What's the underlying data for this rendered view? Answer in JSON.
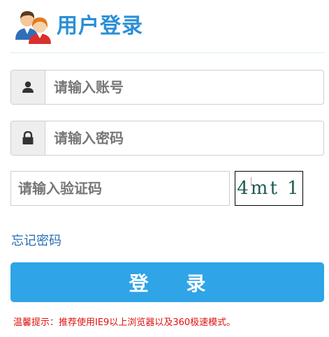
{
  "header": {
    "title": "用户登录",
    "icon": "users-icon"
  },
  "form": {
    "account": {
      "placeholder": "请输入账号",
      "value": "",
      "icon": "user-icon"
    },
    "password": {
      "placeholder": "请输入密码",
      "value": "",
      "icon": "lock-icon"
    },
    "captcha": {
      "placeholder": "请输入验证码",
      "value": "",
      "image_text": "4mt 1"
    },
    "forgot_link": "忘记密码",
    "login_button": "登 录"
  },
  "tip": "温馨提示：推荐使用IE9以上浏览器以及360极速模式。",
  "colors": {
    "brand": "#2a8fd6",
    "button": "#2fa4e7",
    "link": "#2a6db5",
    "warning": "#e01010"
  }
}
